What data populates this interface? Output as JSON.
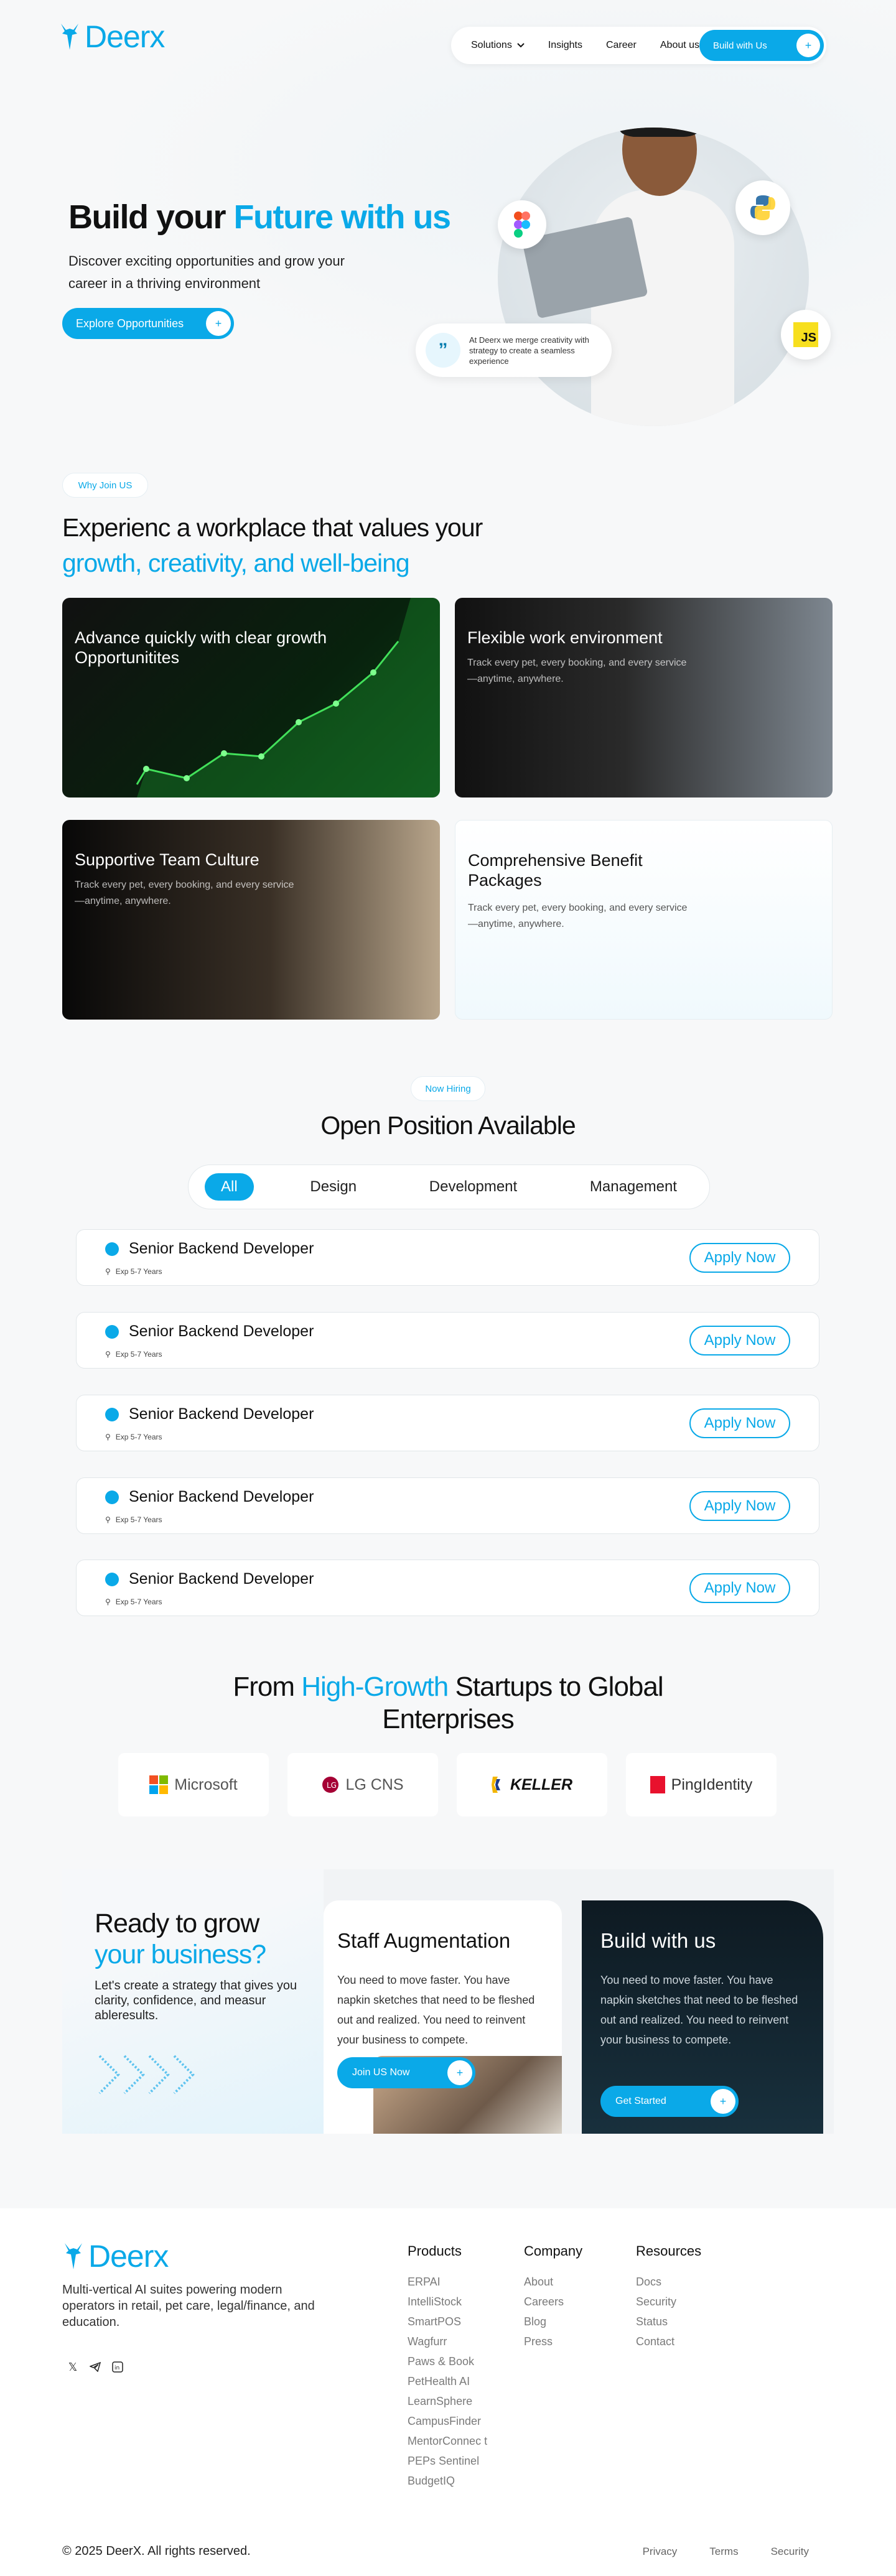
{
  "brand": {
    "name": "Deerx",
    "accent": "#0aa9e8"
  },
  "nav": {
    "items": [
      "Solutions",
      "Insights",
      "Career",
      "About us"
    ],
    "cta": "Build with Us"
  },
  "hero": {
    "title_a": "Build your ",
    "title_b": "Future with us",
    "subtitle": "Discover exciting opportunities and grow your career in a thriving environment",
    "button": "Explore Opportunities",
    "quote": "At Deerx we merge creativity with strategy to create a seamless experience",
    "badge_js": "JS"
  },
  "why": {
    "pill": "Why Join US",
    "title_a": "Experienc a workplace that values your",
    "title_b": "growth, creativity, and well-being",
    "cards": [
      {
        "title": "Advance quickly with clear growth Opportunitites",
        "body": ""
      },
      {
        "title": "Flexible work environment",
        "body": "Track every pet, every booking, and every service—anytime, anywhere."
      },
      {
        "title": "Supportive Team Culture",
        "body": "Track every pet, every booking, and every service—anytime, anywhere."
      },
      {
        "title": "Comprehensive Benefit Packages",
        "body": "Track every pet, every booking, and every service—anytime, anywhere."
      }
    ]
  },
  "positions": {
    "pill": "Now Hiring",
    "title": "Open Position Available",
    "tabs": [
      "All",
      "Design",
      "Development",
      "Management"
    ],
    "jobs": [
      {
        "title": "Senior Backend Developer",
        "exp": "Exp 5-7 Years",
        "apply": "Apply Now"
      },
      {
        "title": "Senior Backend Developer",
        "exp": "Exp 5-7 Years",
        "apply": "Apply Now"
      },
      {
        "title": "Senior Backend Developer",
        "exp": "Exp 5-7 Years",
        "apply": "Apply Now"
      },
      {
        "title": "Senior Backend Developer",
        "exp": "Exp 5-7 Years",
        "apply": "Apply Now"
      },
      {
        "title": "Senior Backend Developer",
        "exp": "Exp 5-7 Years",
        "apply": "Apply Now"
      }
    ]
  },
  "partners": {
    "title_a": "From ",
    "title_b": "High-Growth",
    "title_c": " Startups to Global",
    "title_d": "Enterprises",
    "logos": [
      "Microsoft",
      "LG CNS",
      "KELLER",
      "PingIdentity"
    ]
  },
  "cta": {
    "title_a": "Ready to grow",
    "title_b": "your business?",
    "body": "Let's create a strategy that gives you clarity, confidence, and measur ableresults.",
    "staff": {
      "title": "Staff Augmentation",
      "body": "You need to move faster. You have napkin sketches that need to be fleshed out and realized. You need to reinvent your business to compete.",
      "button": "Join US Now"
    },
    "build": {
      "title": "Build with us",
      "body": "You need to move faster. You have napkin sketches that need to be fleshed out and realized. You need to reinvent your business to compete.",
      "button": "Get Started"
    }
  },
  "footer": {
    "description": "Multi-vertical AI suites powering modern operators in retail, pet care, legal/finance, and education.",
    "products_title": "Products",
    "products": [
      "ERPAI",
      "IntelliStock",
      "SmartPOS",
      "Wagfurr",
      "Paws & Book",
      "PetHealth AI",
      "LearnSphere",
      "CampusFinder",
      "MentorConnec t",
      "PEPs Sentinel",
      "BudgetIQ"
    ],
    "company_title": "Company",
    "company": [
      "About",
      "Careers",
      "Blog",
      "Press"
    ],
    "resources_title": "Resources",
    "resources": [
      "Docs",
      "Security",
      "Status",
      "Contact"
    ],
    "copyright": "© 2025 DeerX. All rights reserved.",
    "legal": [
      "Privacy",
      "Terms",
      "Security"
    ]
  }
}
